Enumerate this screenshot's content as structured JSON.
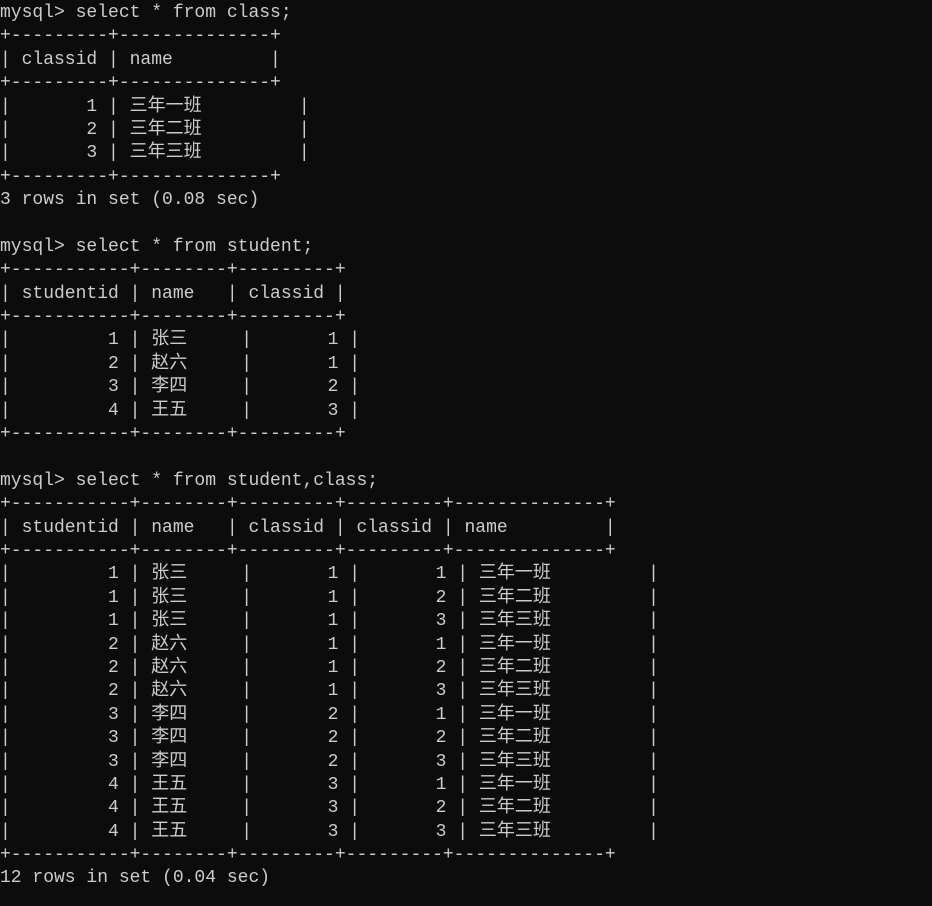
{
  "query1": {
    "prompt": "mysql>",
    "command": "select * from class;",
    "border_top": "+---------+----------+",
    "header": {
      "c1": "classid",
      "c2": "name"
    },
    "border_mid": "+---------+----------+",
    "rows": [
      {
        "c1": "1",
        "c2": "三年一班"
      },
      {
        "c1": "2",
        "c2": "三年二班"
      },
      {
        "c1": "3",
        "c2": "三年三班"
      }
    ],
    "border_bot": "+---------+----------+",
    "footer": "3 rows in set (0.08 sec)"
  },
  "query2": {
    "prompt": "mysql>",
    "command": "select * from student;",
    "border_top": "+-----------+------+---------+",
    "header": {
      "c1": "studentid",
      "c2": "name",
      "c3": "classid"
    },
    "border_mid": "+-----------+------+---------+",
    "rows": [
      {
        "c1": "1",
        "c2": "张三",
        "c3": "1"
      },
      {
        "c1": "2",
        "c2": "赵六",
        "c3": "1"
      },
      {
        "c1": "3",
        "c2": "李四",
        "c3": "2"
      },
      {
        "c1": "4",
        "c2": "王五",
        "c3": "3"
      }
    ],
    "border_bot": "+-----------+------+---------+"
  },
  "query3": {
    "prompt": "mysql>",
    "command": "select * from student,class;",
    "border_top": "+-----------+------+---------+---------+----------+",
    "header": {
      "c1": "studentid",
      "c2": "name",
      "c3": "classid",
      "c4": "classid",
      "c5": "name"
    },
    "border_mid": "+-----------+------+---------+---------+----------+",
    "rows": [
      {
        "c1": "1",
        "c2": "张三",
        "c3": "1",
        "c4": "1",
        "c5": "三年一班"
      },
      {
        "c1": "1",
        "c2": "张三",
        "c3": "1",
        "c4": "2",
        "c5": "三年二班"
      },
      {
        "c1": "1",
        "c2": "张三",
        "c3": "1",
        "c4": "3",
        "c5": "三年三班"
      },
      {
        "c1": "2",
        "c2": "赵六",
        "c3": "1",
        "c4": "1",
        "c5": "三年一班"
      },
      {
        "c1": "2",
        "c2": "赵六",
        "c3": "1",
        "c4": "2",
        "c5": "三年二班"
      },
      {
        "c1": "2",
        "c2": "赵六",
        "c3": "1",
        "c4": "3",
        "c5": "三年三班"
      },
      {
        "c1": "3",
        "c2": "李四",
        "c3": "2",
        "c4": "1",
        "c5": "三年一班"
      },
      {
        "c1": "3",
        "c2": "李四",
        "c3": "2",
        "c4": "2",
        "c5": "三年二班"
      },
      {
        "c1": "3",
        "c2": "李四",
        "c3": "2",
        "c4": "3",
        "c5": "三年三班"
      },
      {
        "c1": "4",
        "c2": "王五",
        "c3": "3",
        "c4": "1",
        "c5": "三年一班"
      },
      {
        "c1": "4",
        "c2": "王五",
        "c3": "3",
        "c4": "2",
        "c5": "三年二班"
      },
      {
        "c1": "4",
        "c2": "王五",
        "c3": "3",
        "c4": "3",
        "c5": "三年三班"
      }
    ],
    "border_bot": "+-----------+------+---------+---------+----------+",
    "footer": "12 rows in set (0.04 sec)"
  }
}
